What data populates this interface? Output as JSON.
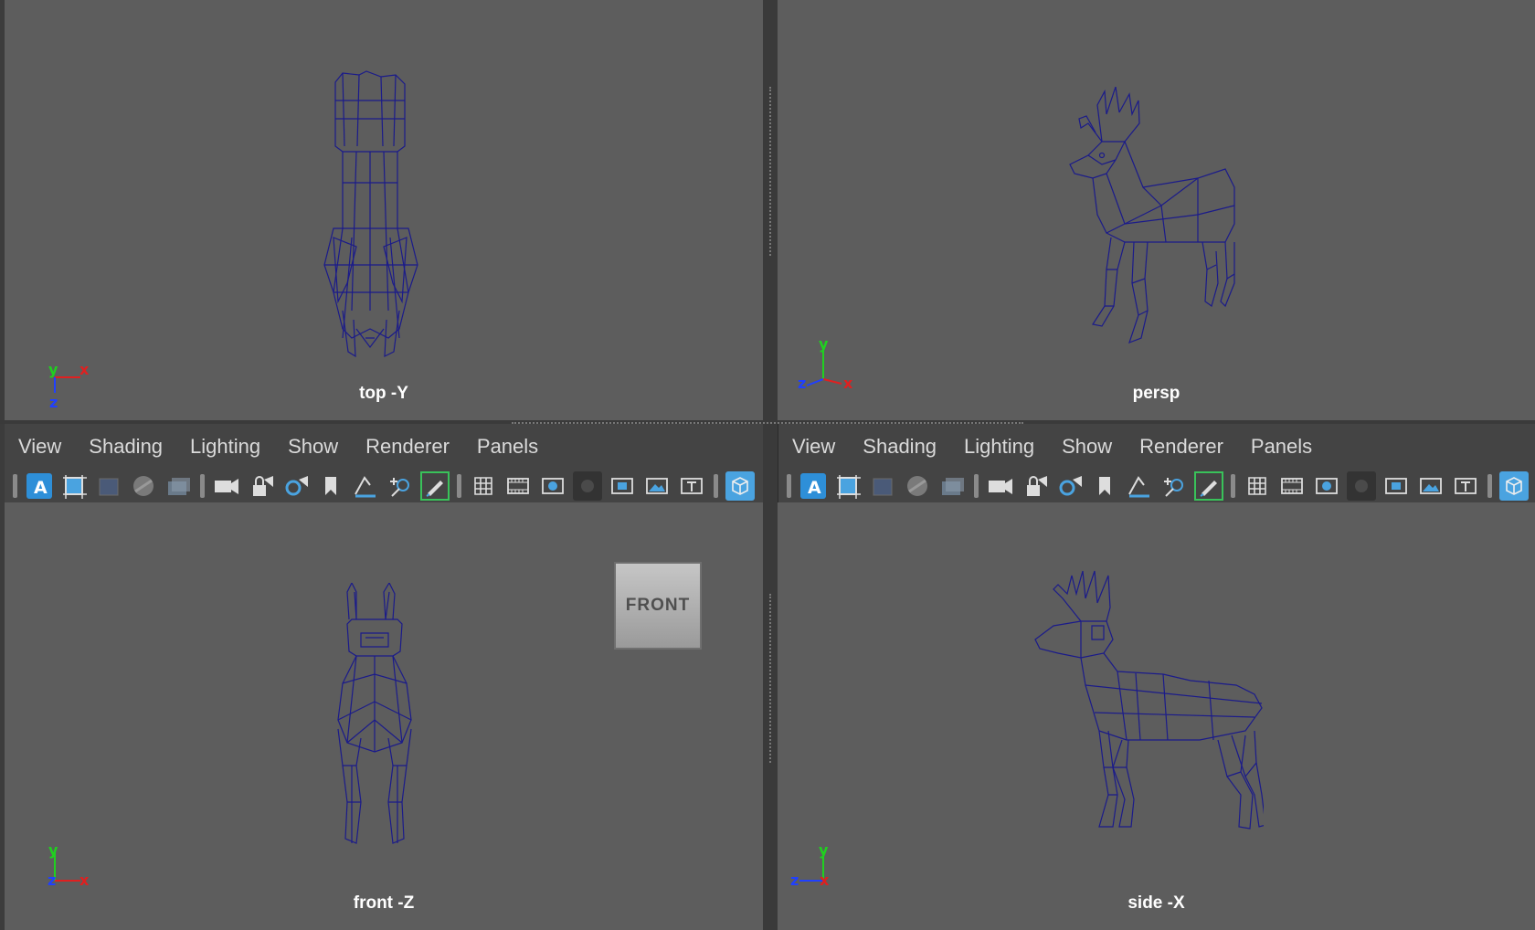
{
  "viewports": {
    "top": {
      "label": "top -Y"
    },
    "persp": {
      "label": "persp"
    },
    "front": {
      "label": "front -Z",
      "view_cube": "FRONT"
    },
    "side": {
      "label": "side -X"
    }
  },
  "panel_menus": [
    "View",
    "Shading",
    "Lighting",
    "Show",
    "Renderer",
    "Panels"
  ],
  "axis_labels": {
    "x": "x",
    "y": "y",
    "z": "z"
  },
  "colors": {
    "viewport_bg": "#5d5d5d",
    "wireframe": "#1b1b8a",
    "axis_x": "#e02020",
    "axis_y": "#20d020",
    "axis_z": "#2040ff",
    "active_tool_border": "#39c25a"
  },
  "toolbar_icons": [
    "select-camera-icon",
    "camera-attributes-icon",
    "bookmark-icon",
    "image-plane-icon",
    "camera-icon",
    "lock-camera-icon",
    "camera-settings-icon",
    "bookmark-flag-icon",
    "2d-pan-zoom-icon",
    "grease-pencil-icon",
    "grid-icon",
    "film-gate-icon",
    "resolution-gate-icon",
    "gate-mask-icon",
    "field-chart-icon",
    "safe-action-icon",
    "safe-title-icon",
    "view-cube-icon"
  ]
}
